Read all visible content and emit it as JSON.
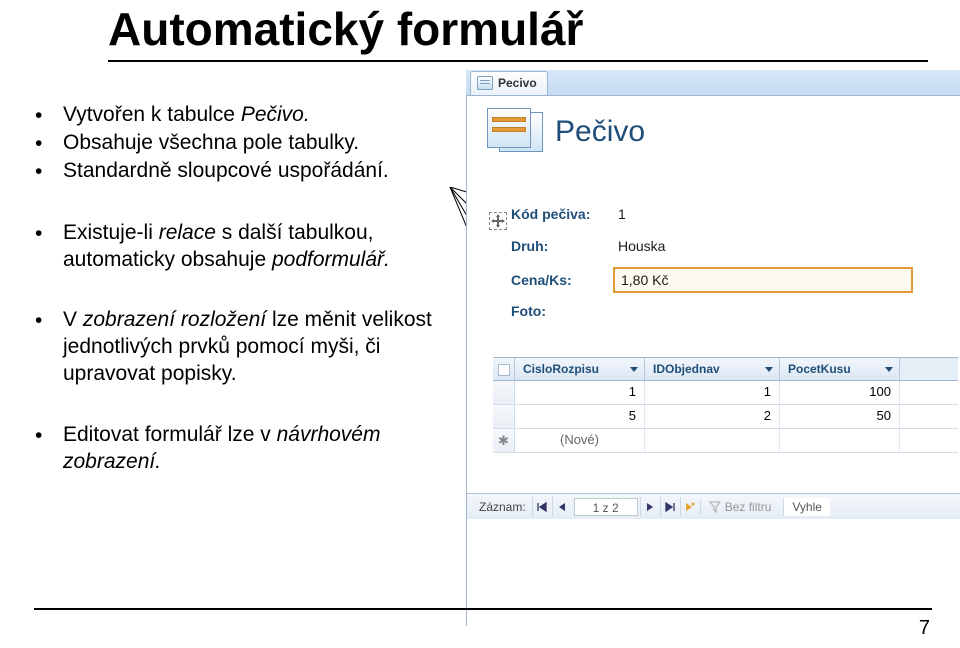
{
  "title": "Automatický formulář",
  "bullets": {
    "b1_pre": "Vytvořen k tabulce ",
    "b1_it": "Pečivo.",
    "b2": "Obsahuje všechna pole tabulky.",
    "b3": "Standardně sloupcové uspořádání.",
    "b4_a": "Existuje-li ",
    "b4_it1": "relace ",
    "b4_b": " s další tabulkou, automaticky obsahuje ",
    "b4_it2": "podformulář.",
    "b5_a": "V ",
    "b5_it": "zobrazení rozložení ",
    "b5_b": " lze měnit velikost jednotlivých prvků pomocí myši, či upravovat popisky.",
    "b6_a": "Editovat  formulář lze v ",
    "b6_it": "návrhovém zobrazení."
  },
  "tab": {
    "label": "Pecivo"
  },
  "form": {
    "title": "Pečivo",
    "fields": {
      "kod_label": "Kód pečiva:",
      "kod_value": "1",
      "druh_label": "Druh:",
      "druh_value": "Houska",
      "cena_label": "Cena/Ks:",
      "cena_value": "1,80 Kč",
      "foto_label": "Foto:"
    }
  },
  "subform": {
    "cols": {
      "c1": "CisloRozpisu",
      "c2": "IDObjednav",
      "c3": "PocetKusu"
    },
    "rows": [
      {
        "c1": "1",
        "c2": "1",
        "c3": "100"
      },
      {
        "c1": "5",
        "c2": "2",
        "c3": "50"
      }
    ],
    "new_label": "(Nové)"
  },
  "nav": {
    "label": "Záznam:",
    "counter": "1 z 2",
    "filter": "Bez filtru",
    "search": "Vyhle"
  },
  "page_number": "7"
}
